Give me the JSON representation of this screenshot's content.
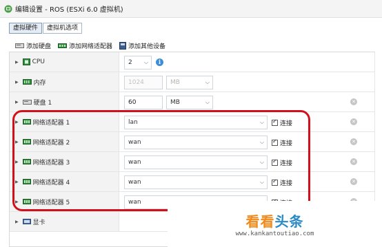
{
  "window": {
    "title": "编辑设置 - ROS (ESXi 6.0 虚拟机)",
    "icon": "vm-edit-icon"
  },
  "tabs": [
    {
      "label": "虚拟硬件",
      "active": true
    },
    {
      "label": "虚拟机选项",
      "active": false
    }
  ],
  "toolbar": {
    "add_disk": "添加硬盘",
    "add_nic": "添加网络适配器",
    "add_other": "添加其他设备"
  },
  "hardware": {
    "cpu": {
      "label": "CPU",
      "value": "2"
    },
    "memory": {
      "label": "内存",
      "value": "1024",
      "unit": "MB"
    },
    "disk1": {
      "label": "硬盘 1",
      "value": "60",
      "unit": "MB"
    },
    "nics": [
      {
        "label": "网络适配器 1",
        "network": "lan",
        "connect": "连接"
      },
      {
        "label": "网络适配器 2",
        "network": "wan",
        "connect": "连接"
      },
      {
        "label": "网络适配器 3",
        "network": "wan",
        "connect": "连接"
      },
      {
        "label": "网络适配器 4",
        "network": "wan",
        "connect": "连接"
      },
      {
        "label": "网络适配器 5",
        "network": "wan",
        "connect": "连接"
      }
    ],
    "display": {
      "label": "显卡"
    }
  },
  "watermark": {
    "a": "看看",
    "b": "头条",
    "url": "www.kankantoutiao.com"
  },
  "colors": {
    "highlight": "#d0111b",
    "info": "#3d8ed6",
    "tab_active": "#e4ecf6"
  }
}
